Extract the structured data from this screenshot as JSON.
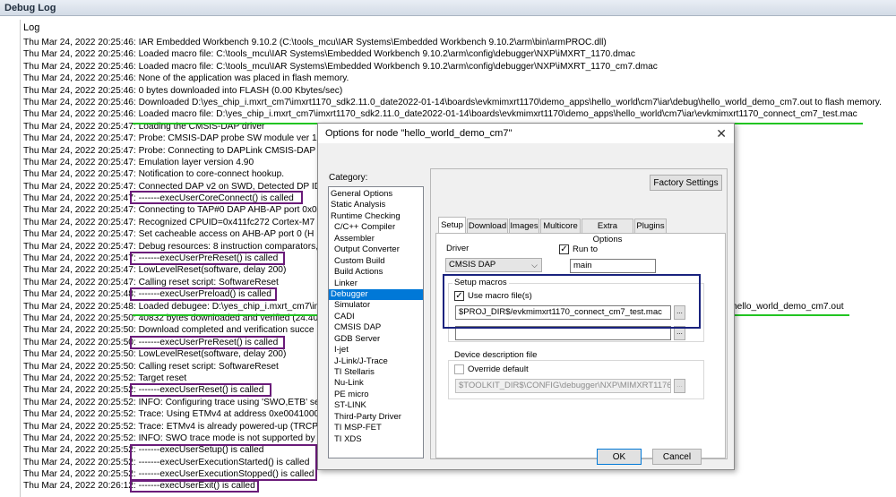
{
  "window": {
    "title": "Debug Log"
  },
  "log": {
    "header": "Log",
    "lines": [
      {
        "ts": "Thu Mar 24, 2022 20:25:46:",
        "msg": "IAR Embedded Workbench 9.10.2 (C:\\tools_mcu\\IAR Systems\\Embedded Workbench 9.10.2\\arm\\bin\\armPROC.dll)"
      },
      {
        "ts": "Thu Mar 24, 2022 20:25:46:",
        "msg": "Loaded macro file: C:\\tools_mcu\\IAR Systems\\Embedded Workbench 9.10.2\\arm\\config\\debugger\\NXP\\iMXRT_1170.dmac"
      },
      {
        "ts": "Thu Mar 24, 2022 20:25:46:",
        "msg": "Loaded macro file: C:\\tools_mcu\\IAR Systems\\Embedded Workbench 9.10.2\\arm\\config\\debugger\\NXP\\iMXRT_1170_cm7.dmac"
      },
      {
        "ts": "Thu Mar 24, 2022 20:25:46:",
        "msg": "None of the application was placed in flash memory."
      },
      {
        "ts": "Thu Mar 24, 2022 20:25:46:",
        "msg": "0 bytes downloaded into FLASH (0.00 Kbytes/sec)"
      },
      {
        "ts": "Thu Mar 24, 2022 20:25:46:",
        "msg": "Downloaded D:\\yes_chip_i.mxrt_cm7\\imxrt1170_sdk2.11.0_date2022-01-14\\boards\\evkmimxrt1170\\demo_apps\\hello_world\\cm7\\iar\\debug\\hello_world_demo_cm7.out to flash memory."
      },
      {
        "ts": "Thu Mar 24, 2022 20:25:46:",
        "msg": "Loaded macro file: D:\\yes_chip_i.mxrt_cm7\\imxrt1170_sdk2.11.0_date2022-01-14\\boards\\evkmimxrt1170\\demo_apps\\hello_world\\cm7\\iar\\evkmimxrt1170_connect_cm7_test.mac"
      },
      {
        "ts": "Thu Mar 24, 2022 20:25:47:",
        "msg": "Loading the CMSIS-DAP driver"
      },
      {
        "ts": "Thu Mar 24, 2022 20:25:47:",
        "msg": "Probe: CMSIS-DAP probe SW module ver 1"
      },
      {
        "ts": "Thu Mar 24, 2022 20:25:47:",
        "msg": "Probe: Connecting to DAPLink CMSIS-DAP"
      },
      {
        "ts": "Thu Mar 24, 2022 20:25:47:",
        "msg": "Emulation layer version 4.90"
      },
      {
        "ts": "Thu Mar 24, 2022 20:25:47:",
        "msg": "Notification to core-connect hookup."
      },
      {
        "ts": "Thu Mar 24, 2022 20:25:47:",
        "msg": "Connected DAP v2 on SWD, Detected DP ID"
      },
      {
        "ts": "Thu Mar 24, 2022 20:25:47:",
        "msg": "-------execUserCoreConnect() is called"
      },
      {
        "ts": "Thu Mar 24, 2022 20:25:47:",
        "msg": "Connecting to TAP#0 DAP AHB-AP port 0x0"
      },
      {
        "ts": "Thu Mar 24, 2022 20:25:47:",
        "msg": "Recognized CPUID=0x411fc272 Cortex-M7 r"
      },
      {
        "ts": "Thu Mar 24, 2022 20:25:47:",
        "msg": "Set cacheable access on AHB-AP port 0 (H"
      },
      {
        "ts": "Thu Mar 24, 2022 20:25:47:",
        "msg": "Debug resources: 8 instruction comparators,"
      },
      {
        "ts": "Thu Mar 24, 2022 20:25:47:",
        "msg": "-------execUserPreReset() is called"
      },
      {
        "ts": "Thu Mar 24, 2022 20:25:47:",
        "msg": "LowLevelReset(software, delay 200)"
      },
      {
        "ts": "Thu Mar 24, 2022 20:25:47:",
        "msg": "Calling reset script: SoftwareReset"
      },
      {
        "ts": "Thu Mar 24, 2022 20:25:48:",
        "msg": "-------execUserPreload() is called"
      },
      {
        "ts": "Thu Mar 24, 2022 20:25:48:",
        "msg": "Loaded debugee: D:\\yes_chip_i.mxrt_cm7\\imxr"
      },
      {
        "ts": "Thu Mar 24, 2022 20:25:50:",
        "msg": "40832 bytes downloaded and verified (24.40"
      },
      {
        "ts": "Thu Mar 24, 2022 20:25:50:",
        "msg": "Download completed and verification succe"
      },
      {
        "ts": "Thu Mar 24, 2022 20:25:50:",
        "msg": "-------execUserPreReset() is called"
      },
      {
        "ts": "Thu Mar 24, 2022 20:25:50:",
        "msg": "LowLevelReset(software, delay 200)"
      },
      {
        "ts": "Thu Mar 24, 2022 20:25:50:",
        "msg": "Calling reset script: SoftwareReset"
      },
      {
        "ts": "Thu Mar 24, 2022 20:25:52:",
        "msg": "Target reset"
      },
      {
        "ts": "Thu Mar 24, 2022 20:25:52:",
        "msg": "-------execUserReset() is called"
      },
      {
        "ts": "Thu Mar 24, 2022 20:25:52:",
        "msg": "INFO: Configuring trace using 'SWO,ETB' se"
      },
      {
        "ts": "Thu Mar 24, 2022 20:25:52:",
        "msg": "Trace: Using ETMv4 at address 0xe0041000"
      },
      {
        "ts": "Thu Mar 24, 2022 20:25:52:",
        "msg": "Trace: ETMv4 is already powered-up (TRCP"
      },
      {
        "ts": "Thu Mar 24, 2022 20:25:52:",
        "msg": "INFO: SWO trace mode is not supported by t"
      },
      {
        "ts": "Thu Mar 24, 2022 20:25:52:",
        "msg": "-------execUserSetup() is called"
      },
      {
        "ts": "Thu Mar 24, 2022 20:25:52:",
        "msg": "-------execUserExecutionStarted() is called"
      },
      {
        "ts": "Thu Mar 24, 2022 20:25:52:",
        "msg": "-------execUserExecutionStopped() is called"
      },
      {
        "ts": "Thu Mar 24, 2022 20:26:12:",
        "msg": "-------execUserExit() is called"
      }
    ],
    "overlay_filename": "hello_world_demo_cm7.out"
  },
  "dialog": {
    "title": "Options for node \"hello_world_demo_cm7\"",
    "close_glyph": "✕",
    "category_label": "Category:",
    "categories": [
      {
        "label": "General Options",
        "sub": false,
        "selected": false
      },
      {
        "label": "Static Analysis",
        "sub": false,
        "selected": false
      },
      {
        "label": "Runtime Checking",
        "sub": false,
        "selected": false
      },
      {
        "label": "C/C++ Compiler",
        "sub": true,
        "selected": false
      },
      {
        "label": "Assembler",
        "sub": true,
        "selected": false
      },
      {
        "label": "Output Converter",
        "sub": true,
        "selected": false
      },
      {
        "label": "Custom Build",
        "sub": true,
        "selected": false
      },
      {
        "label": "Build Actions",
        "sub": true,
        "selected": false
      },
      {
        "label": "Linker",
        "sub": true,
        "selected": false
      },
      {
        "label": "Debugger",
        "sub": false,
        "selected": true
      },
      {
        "label": "Simulator",
        "sub": true,
        "selected": false
      },
      {
        "label": "CADI",
        "sub": true,
        "selected": false
      },
      {
        "label": "CMSIS DAP",
        "sub": true,
        "selected": false
      },
      {
        "label": "GDB Server",
        "sub": true,
        "selected": false
      },
      {
        "label": "I-jet",
        "sub": true,
        "selected": false
      },
      {
        "label": "J-Link/J-Trace",
        "sub": true,
        "selected": false
      },
      {
        "label": "TI Stellaris",
        "sub": true,
        "selected": false
      },
      {
        "label": "Nu-Link",
        "sub": true,
        "selected": false
      },
      {
        "label": "PE micro",
        "sub": true,
        "selected": false
      },
      {
        "label": "ST-LINK",
        "sub": true,
        "selected": false
      },
      {
        "label": "Third-Party Driver",
        "sub": true,
        "selected": false
      },
      {
        "label": "TI MSP-FET",
        "sub": true,
        "selected": false
      },
      {
        "label": "TI XDS",
        "sub": true,
        "selected": false
      }
    ],
    "factory_settings": "Factory Settings",
    "tabs": [
      "Setup",
      "Download",
      "Images",
      "Multicore",
      "Extra Options",
      "Plugins"
    ],
    "active_tab": "Setup",
    "setup": {
      "driver_label": "Driver",
      "driver_value": "CMSIS DAP",
      "run_to_label": "Run to",
      "run_to_checked": true,
      "run_to_value": "main",
      "setup_macros_label": "Setup macros",
      "use_macro_label": "Use macro file(s)",
      "use_macro_checked": true,
      "macro_file_1": "$PROJ_DIR$/evkmimxrt1170_connect_cm7_test.mac",
      "macro_file_2": "",
      "browse_glyph": "...",
      "device_desc_label": "Device description file",
      "override_label": "Override default",
      "override_checked": false,
      "device_desc_value": "$TOOLKIT_DIR$\\CONFIG\\debugger\\NXP\\MIMXRT1176xxxA"
    },
    "ok_label": "OK",
    "cancel_label": "Cancel"
  },
  "colors": {
    "highlight_purple": "#6a1b79",
    "highlight_green": "#22c422",
    "highlight_blue": "#1a237e",
    "selection_blue": "#0078d7"
  }
}
